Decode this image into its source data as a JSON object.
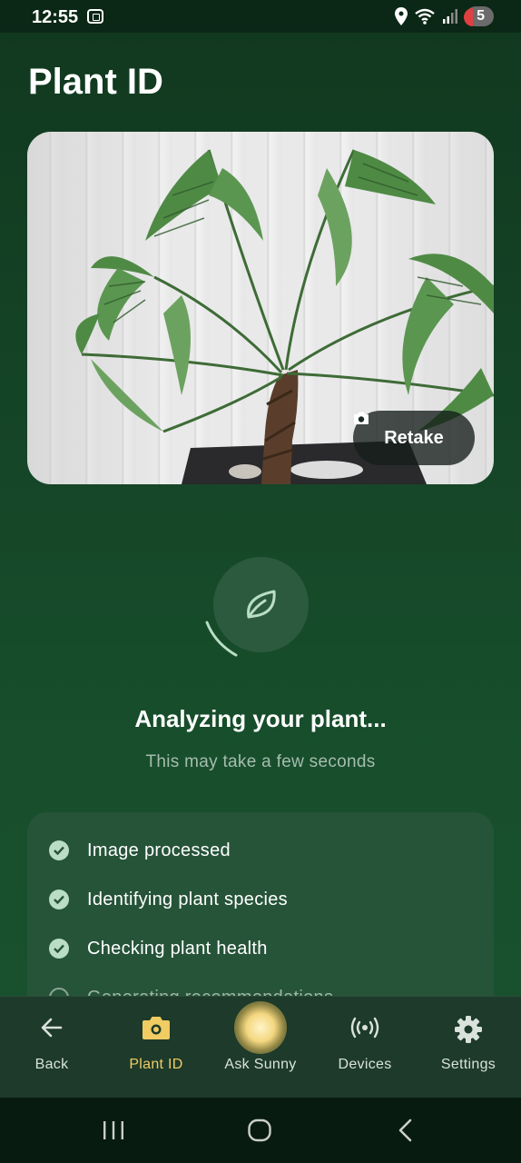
{
  "status_bar": {
    "time": "12:55",
    "notification_count": "5",
    "icons": [
      "screenshot-icon",
      "location-icon",
      "wifi-icon",
      "signal-icon"
    ]
  },
  "page": {
    "title": "Plant ID"
  },
  "photo": {
    "retake_label": "Retake"
  },
  "analysis": {
    "title": "Analyzing your plant...",
    "subtitle": "This may take a few seconds"
  },
  "steps": [
    {
      "label": "Image processed",
      "done": true
    },
    {
      "label": "Identifying plant species",
      "done": true
    },
    {
      "label": "Checking plant health",
      "done": true
    },
    {
      "label": "Generating recommendations",
      "done": false
    }
  ],
  "bottom_nav": [
    {
      "label": "Back",
      "icon": "arrow-left-icon",
      "active": false
    },
    {
      "label": "Plant ID",
      "icon": "camera-icon",
      "active": true
    },
    {
      "label": "Ask Sunny",
      "icon": "sunny-orb-icon",
      "active": false
    },
    {
      "label": "Devices",
      "icon": "broadcast-icon",
      "active": false
    },
    {
      "label": "Settings",
      "icon": "gear-icon",
      "active": false
    }
  ],
  "colors": {
    "background": "#174d2b",
    "accent": "#f1cc62",
    "check": "#b9ddc5",
    "card": "#265438"
  }
}
